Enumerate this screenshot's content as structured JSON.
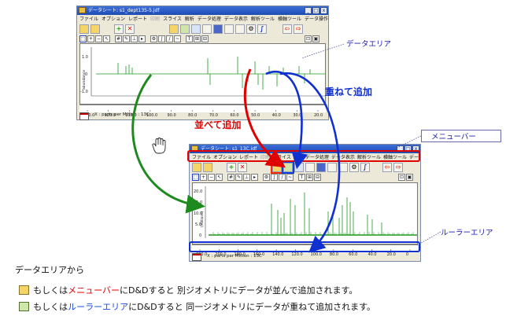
{
  "window_top": {
    "title": "データシート: s1_dept135-5.jdf",
    "menu": [
      "ファイル",
      "オプション",
      "レポート",
      "印刷",
      "スライス",
      "解析",
      "データ処理",
      "データ表示",
      "解析ツール",
      "横軸ツール",
      "データ操作"
    ],
    "status": "X : parts per Million : 13C",
    "ylabel": "abundance",
    "y_ticks": [
      "1.0",
      "0",
      "-1.0"
    ],
    "x_ticks": [
      "130.0",
      "120.0",
      "110.0",
      "100.0",
      "90.0",
      "80.0",
      "70.0",
      "60.0",
      "50.0",
      "40.0",
      "30.0",
      "20.0"
    ]
  },
  "window_bottom": {
    "title": "データシート: s1_13C.jdf",
    "menu": [
      "ファイル",
      "オプション",
      "レポート",
      "印刷",
      "スライス",
      "解析",
      "データ処理",
      "データ表示",
      "解析ツール",
      "横軸ツール",
      "データ操作"
    ],
    "status": "X : parts per Million : 13C",
    "ylabel": "(Millions)",
    "y_ticks": [
      "20.0",
      "15.0",
      "10.0",
      "5.0",
      "0"
    ],
    "x_ticks": [
      "220.0",
      "200.0",
      "180.0",
      "160.0",
      "140.0",
      "120.0",
      "100.0",
      "80.0",
      "60.0",
      "40.0",
      "20.0",
      "0"
    ]
  },
  "callouts": {
    "data_area": "データエリア",
    "menu_bar": "メニューバー",
    "ruler_area": "ルーラーエリア",
    "overlay_add": "重ねて追加",
    "side_add": "並べて追加"
  },
  "footer": {
    "line1": "データエリアから",
    "line2_a": "もしくは",
    "line2_hl": "メニューバー",
    "line2_b": "にD&Dすると 別ジオメトリにデータが並んで追加されます。",
    "line3_a": "もしくは",
    "line3_hl": "ルーラーエリア",
    "line3_b": "にD&Dすると 同一ジオメトリにデータが重ねて追加されます。"
  },
  "colors": {
    "spectrum": "#1e9a1e",
    "arrow_green": "#1e8a1e",
    "arrow_red": "#e00000",
    "arrow_blue": "#1030d0",
    "callout": "#1a1ab0"
  }
}
